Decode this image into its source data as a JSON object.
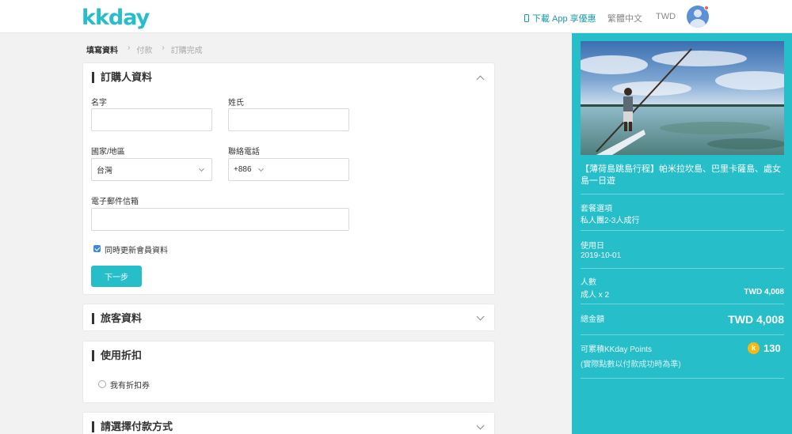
{
  "header": {
    "logo": "kkday",
    "app_link": "下載 App 享優惠",
    "language": "繁體中文",
    "currency": "TWD"
  },
  "breadcrumb": [
    "填寫資料",
    "付款",
    "訂購完成"
  ],
  "orderer": {
    "title": "訂購人資料",
    "first_name_label": "名字",
    "last_name_label": "姓氏",
    "first_name_value": "",
    "last_name_value": "",
    "country_label": "國家/地區",
    "country_value": "台灣",
    "phone_label": "聯絡電話",
    "phone_code": "+886",
    "email_label": "電子郵件信箱",
    "email_value": "",
    "update_member_label": "同時更新會員資料",
    "next_button": "下一步"
  },
  "traveler": {
    "title": "旅客資料"
  },
  "discount": {
    "title": "使用折扣",
    "coupon_label": "我有折扣券"
  },
  "payment": {
    "title": "請選擇付款方式"
  },
  "sidebar": {
    "product_title": "【薄荷島跳島行程】帕米拉坎島、巴里卡薩島、處女島一日遊",
    "package_label": "套餐選項",
    "package_value": "私人團2-3人成行",
    "date_label": "使用日",
    "date_value": "2019-10-01",
    "people_label": "人數",
    "people_value": "成人 x 2",
    "people_price": "TWD 4,008",
    "total_label": "總金額",
    "total_value": "TWD 4,008",
    "points_label": "可累積KKday Points",
    "points_note": "(實際點數以付款成功時為準)",
    "points_coin": "k",
    "points_value": "130"
  },
  "colors": {
    "brand": "#26bec9",
    "checkbox": "#3d8be0",
    "coin": "#f5b815"
  }
}
